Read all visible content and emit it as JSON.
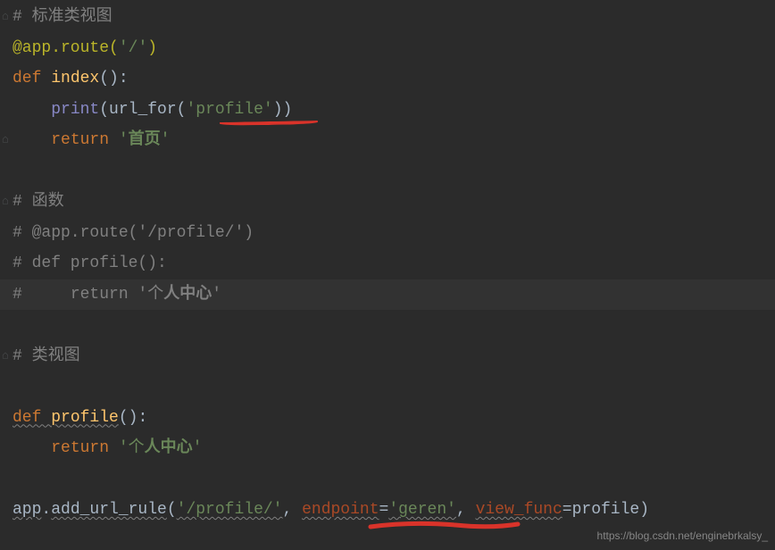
{
  "lines": {
    "l1": {
      "comment_hash": "# ",
      "comment_text1": "标准",
      "comment_text2": "类视图"
    },
    "l2": {
      "deco_prefix": "@app.route",
      "paren_open": "(",
      "route_str": "'/'",
      "paren_close": ")"
    },
    "l3": {
      "kw_def": "def ",
      "fname": "index",
      "sig": "():"
    },
    "l4": {
      "indent": "    ",
      "builtin": "print",
      "open": "(",
      "fn": "url_for",
      "open2": "(",
      "arg": "'profile'",
      "close2": ")",
      "close": ")"
    },
    "l5": {
      "indent": "    ",
      "kw": "return ",
      "str_open": "'",
      "str_cjk": "首页",
      "str_close": "'"
    },
    "l6": {},
    "l7": {
      "hash": "# ",
      "text1": "函",
      "text2": "数"
    },
    "l8": {
      "text": "# @app.route('/profile/')"
    },
    "l9": {
      "text": "# def profile():"
    },
    "l10": {
      "hash": "#     ",
      "ret": "return '",
      "cjk1": "个",
      "cjk2": "人中心",
      "close": "'"
    },
    "l11": {},
    "l12": {
      "hash": "# ",
      "text": "类视图"
    },
    "l13": {},
    "l14": {
      "kw_def": "def ",
      "fname": "profile",
      "sig": "():"
    },
    "l15": {
      "indent": "    ",
      "kw": "return ",
      "str_open": "'",
      "cjk1": "个",
      "cjk2": "人中心",
      "str_close": "'"
    },
    "l16": {},
    "l17": {
      "obj": "app",
      "dot": ".",
      "method": "add_url_rule",
      "open": "(",
      "arg1": "'/profile/'",
      "comma1": ", ",
      "kw1": "endpoint",
      "eq1": "=",
      "val1": "'geren'",
      "comma2": ", ",
      "kw2": "view_func",
      "eq2": "=",
      "val2": "profile",
      "close": ")"
    }
  },
  "watermark": "https://blog.csdn.net/enginebrkalsy_"
}
